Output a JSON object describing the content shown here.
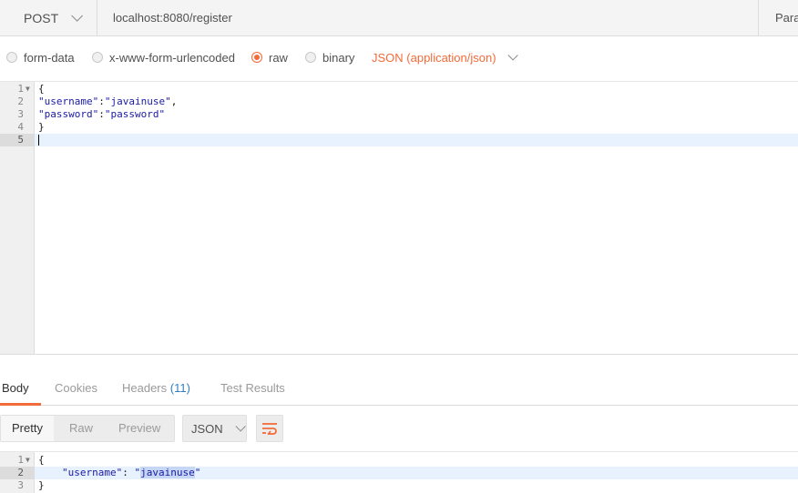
{
  "request": {
    "method": "POST",
    "url": "localhost:8080/register",
    "params_label": "Params"
  },
  "body_options": {
    "form_data": "form-data",
    "urlencoded": "x-www-form-urlencoded",
    "raw": "raw",
    "binary": "binary",
    "selected": "raw",
    "content_type": "JSON (application/json)"
  },
  "request_editor": {
    "lines": [
      {
        "num": "1",
        "text": "{"
      },
      {
        "num": "2",
        "key": "\"username\"",
        "sep": ":",
        "value": "\"javainuse\"",
        "tail": ","
      },
      {
        "num": "3",
        "key": "\"password\"",
        "sep": ":",
        "value": "\"password\"",
        "tail": ""
      },
      {
        "num": "4",
        "text": "}"
      },
      {
        "num": "5",
        "text": ""
      }
    ]
  },
  "response_tabs": {
    "body": "Body",
    "cookies": "Cookies",
    "headers": "Headers",
    "headers_count": "(11)",
    "test_results": "Test Results"
  },
  "response_toolbar": {
    "pretty": "Pretty",
    "raw": "Raw",
    "preview": "Preview",
    "format": "JSON"
  },
  "response_editor": {
    "lines": [
      {
        "num": "1",
        "text": "{"
      },
      {
        "num": "2",
        "key": "\"username\"",
        "sep": ": ",
        "quote": "\"",
        "value": "javainuse",
        "end_quote": "\""
      },
      {
        "num": "3",
        "text": "}"
      }
    ]
  },
  "colors": {
    "accent": "#f26b3a",
    "link": "#2f7fc5"
  }
}
